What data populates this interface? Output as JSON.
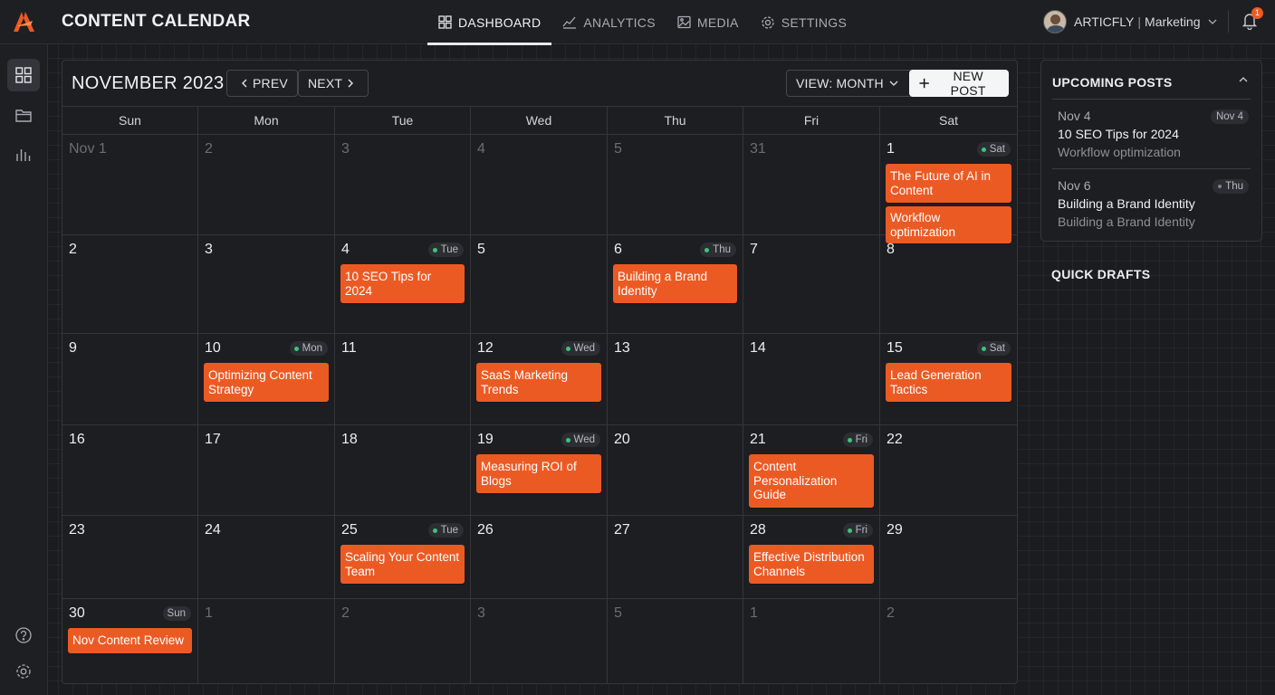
{
  "app": {
    "title": "CONTENT CALENDAR"
  },
  "nav": [
    {
      "label": "DASHBOARD",
      "icon": "dashboard-icon",
      "active": true
    },
    {
      "label": "ANALYTICS",
      "icon": "analytics-icon",
      "active": false
    },
    {
      "label": "MEDIA",
      "icon": "media-icon",
      "active": false
    },
    {
      "label": "SETTINGS",
      "icon": "settings-icon",
      "active": false
    }
  ],
  "user": {
    "org": "ARTICFLY",
    "separator": "|",
    "team": "Marketing"
  },
  "notifications": {
    "count": "1"
  },
  "rail": {
    "top": [
      "grid-icon",
      "folder-icon",
      "chart-icon"
    ],
    "bottom": [
      "help-icon",
      "gear-icon"
    ]
  },
  "calendar": {
    "month": "NOVEMBER 2023",
    "prev_label": "PREV",
    "next_label": "NEXT",
    "view_label": "VIEW: MONTH",
    "new_post_label": "NEW POST",
    "weekdays": [
      "Sun",
      "Mon",
      "Tue",
      "Wed",
      "Thu",
      "Fri",
      "Sat"
    ],
    "weeks": [
      [
        {
          "day": "Nov 1",
          "muted": true
        },
        {
          "day": "2",
          "muted": true
        },
        {
          "day": "3",
          "muted": true
        },
        {
          "day": "4",
          "muted": true
        },
        {
          "day": "5",
          "muted": true
        },
        {
          "day": "31",
          "muted": true
        },
        {
          "day": "1",
          "tag": "Sat",
          "events": [
            "The Future of AI in Content",
            "Workflow optimization"
          ]
        }
      ],
      [
        {
          "day": "2"
        },
        {
          "day": "3"
        },
        {
          "day": "4",
          "tag": "Tue",
          "events": [
            "10 SEO Tips for 2024"
          ]
        },
        {
          "day": "5"
        },
        {
          "day": "6",
          "tag": "Thu",
          "events": [
            "Building a Brand Identity"
          ]
        },
        {
          "day": "7"
        },
        {
          "day": "8"
        }
      ],
      [
        {
          "day": "9"
        },
        {
          "day": "10",
          "tag": "Mon",
          "events": [
            "Optimizing Content Strategy"
          ]
        },
        {
          "day": "11"
        },
        {
          "day": "12",
          "tag": "Wed",
          "events": [
            "SaaS Marketing Trends"
          ]
        },
        {
          "day": "13"
        },
        {
          "day": "14"
        },
        {
          "day": "15",
          "tag": "Sat",
          "events": [
            "Lead Generation Tactics"
          ]
        }
      ],
      [
        {
          "day": "16"
        },
        {
          "day": "17"
        },
        {
          "day": "18"
        },
        {
          "day": "19",
          "tag": "Wed",
          "events": [
            "Measuring ROI of Blogs"
          ]
        },
        {
          "day": "20"
        },
        {
          "day": "21",
          "tag": "Fri",
          "events": [
            "Content Personalization Guide"
          ]
        },
        {
          "day": "22"
        }
      ],
      [
        {
          "day": "23"
        },
        {
          "day": "24"
        },
        {
          "day": "25",
          "tag": "Tue",
          "events": [
            "Scaling Your Content Team"
          ]
        },
        {
          "day": "26"
        },
        {
          "day": "27"
        },
        {
          "day": "28",
          "tag": "Fri",
          "events": [
            "Effective Distribution Channels"
          ]
        },
        {
          "day": "29"
        }
      ],
      [
        {
          "day": "30",
          "tag": "Sun",
          "tag_plain": true,
          "events": [
            "Nov Content Review"
          ]
        },
        {
          "day": "1",
          "muted": true
        },
        {
          "day": "2",
          "muted": true
        },
        {
          "day": "3",
          "muted": true
        },
        {
          "day": "5",
          "muted": true
        },
        {
          "day": "1",
          "muted": true
        },
        {
          "day": "2",
          "muted": true
        }
      ]
    ]
  },
  "upcoming": {
    "title": "UPCOMING POSTS",
    "items": [
      {
        "date": "Nov 4",
        "badge": "Nov 4",
        "title": "10 SEO Tips for 2024",
        "subtitle": "Workflow optimization"
      },
      {
        "date": "Nov 6",
        "badge": "Thu",
        "title": "Building a Brand Identity",
        "subtitle": "Building a Brand Identity"
      }
    ]
  },
  "drafts": {
    "title": "QUICK DRAFTS"
  },
  "colors": {
    "accent": "#ec5a24",
    "dot": "#3cc47c",
    "background": "#1b1c20"
  }
}
